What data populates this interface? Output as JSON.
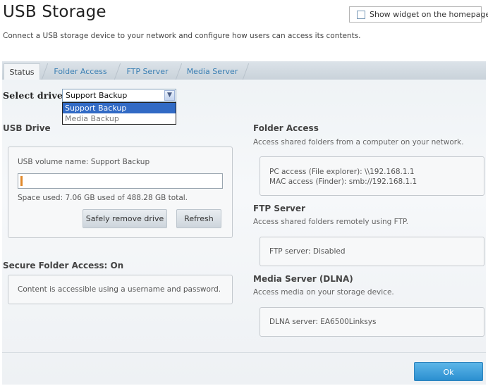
{
  "header": {
    "title": "USB Storage",
    "widget_checkbox_label": "Show widget on the homepage",
    "subtitle": "Connect a USB storage device to your network and configure how users can access its contents."
  },
  "tabs": [
    {
      "label": "Status",
      "active": true
    },
    {
      "label": "Folder Access",
      "active": false
    },
    {
      "label": "FTP Server",
      "active": false
    },
    {
      "label": "Media Server",
      "active": false
    }
  ],
  "select_drive": {
    "label": "Select drive:",
    "value": "Support Backup",
    "options": [
      "Support Backup",
      "Media Backup"
    ]
  },
  "usb_drive": {
    "heading": "USB Drive",
    "volume_name": "USB volume name: Support Backup",
    "space_used": "Space used: 7.06 GB used of 488.28 GB total.",
    "usage_fraction": 0.0145,
    "safely_remove_label": "Safely remove drive",
    "refresh_label": "Refresh"
  },
  "secure_folder": {
    "heading": "Secure Folder Access: On",
    "text": "Content is accessible using a username and password."
  },
  "folder_access": {
    "heading": "Folder Access",
    "desc": "Access shared folders from a computer on your network.",
    "pc": "PC access (File explorer): \\\\192.168.1.1",
    "mac": "MAC access (Finder): smb://192.168.1.1"
  },
  "ftp": {
    "heading": "FTP Server",
    "desc": "Access shared folders remotely using FTP.",
    "status": "FTP server: Disabled"
  },
  "media": {
    "heading": "Media Server (DLNA)",
    "desc": "Access media on your storage device.",
    "status": "DLNA server:  EA6500Linksys"
  },
  "footer": {
    "ok_label": "Ok"
  },
  "colors": {
    "accent": "#3a8fd0",
    "tab_link": "#3a7fb3",
    "selected_option": "#316ac5"
  }
}
